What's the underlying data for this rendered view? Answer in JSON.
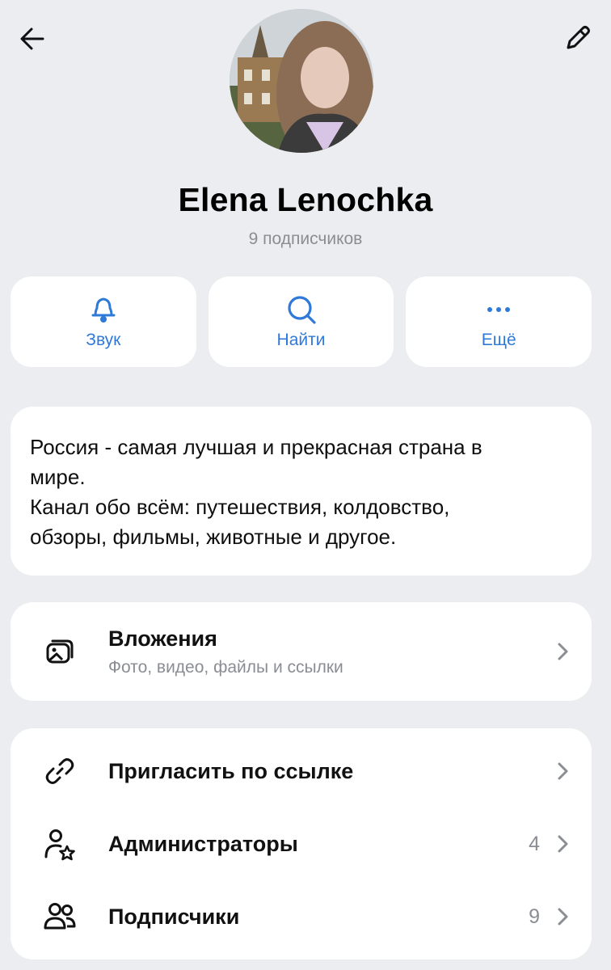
{
  "header": {
    "back_icon": "arrow-left-icon",
    "edit_icon": "pencil-icon"
  },
  "profile": {
    "name": "Elena Lenochka",
    "subscribers": "9 подписчиков"
  },
  "actions": [
    {
      "label": "Звук",
      "icon": "bell-icon"
    },
    {
      "label": "Найти",
      "icon": "search-icon"
    },
    {
      "label": "Ещё",
      "icon": "more-dots-icon"
    }
  ],
  "about": {
    "lines": [
      "Россия - самая лучшая и прекрасная страна в",
      "мире.",
      "Канал обо всём: путешествия, колдовство,",
      "обзоры, фильмы, животные и другое."
    ]
  },
  "attachments": {
    "title": "Вложения",
    "subtitle": "Фото, видео, файлы и ссылки",
    "icon": "gallery-icon"
  },
  "menu": [
    {
      "title": "Пригласить по ссылке",
      "count": "",
      "icon": "link-icon"
    },
    {
      "title": "Администраторы",
      "count": "4",
      "icon": "admin-star-icon"
    },
    {
      "title": "Подписчики",
      "count": "9",
      "icon": "users-icon"
    }
  ],
  "colors": {
    "background": "#ebedf0",
    "accent": "#2f79d8",
    "secondary_text": "#8a8d93"
  }
}
